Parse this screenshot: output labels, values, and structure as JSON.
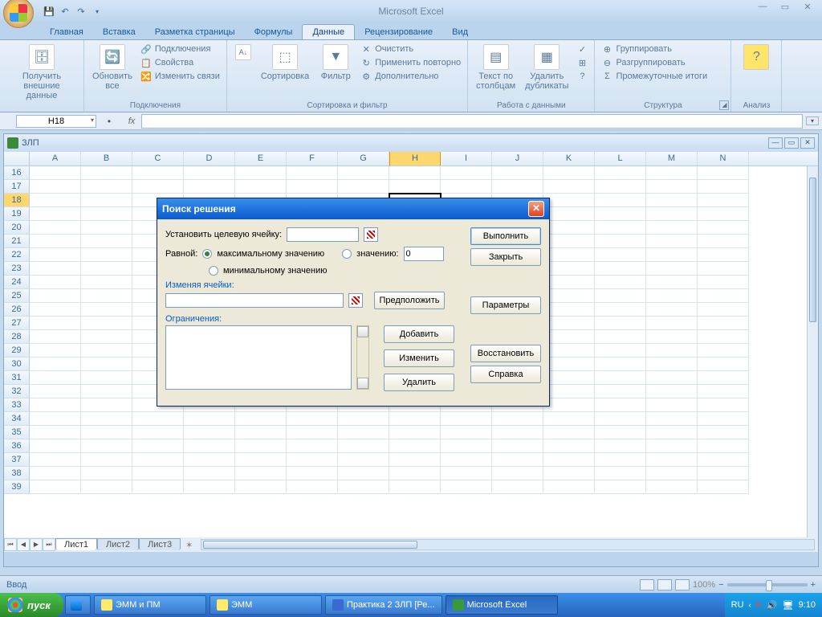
{
  "app": {
    "title": "Microsoft Excel"
  },
  "tabs": [
    "Главная",
    "Вставка",
    "Разметка страницы",
    "Формулы",
    "Данные",
    "Рецензирование",
    "Вид"
  ],
  "active_tab": 4,
  "ribbon": {
    "g1": {
      "btn": "Получить\nвнешние данные",
      "label": ""
    },
    "g2": {
      "btn": "Обновить\nвсе",
      "items": [
        "Подключения",
        "Свойства",
        "Изменить связи"
      ],
      "label": "Подключения"
    },
    "g3": {
      "btn": "Сортировка",
      "btn2": "Фильтр",
      "items": [
        "Очистить",
        "Применить повторно",
        "Дополнительно"
      ],
      "label": "Сортировка и фильтр"
    },
    "g4": {
      "btn1": "Текст по\nстолбцам",
      "btn2": "Удалить\nдубликаты",
      "label": "Работа с данными"
    },
    "g5": {
      "items": [
        "Группировать",
        "Разгруппировать",
        "Промежуточные итоги"
      ],
      "label": "Структура"
    },
    "g6": {
      "label": "Анализ"
    }
  },
  "namebox": "H18",
  "workbook": {
    "title": "ЗЛП",
    "cols": [
      "A",
      "B",
      "C",
      "D",
      "E",
      "F",
      "G",
      "H",
      "I",
      "J",
      "K",
      "L",
      "M",
      "N"
    ],
    "first_row": 16,
    "row_count": 24,
    "active": {
      "row": 18,
      "col": "H"
    },
    "sheets": [
      "Лист1",
      "Лист2",
      "Лист3"
    ]
  },
  "status": {
    "left": "Ввод",
    "zoom": "100%"
  },
  "dialog": {
    "title": "Поиск решения",
    "target_label": "Установить целевую ячейку:",
    "equal_label": "Равной:",
    "opt_max": "максимальному значению",
    "opt_value": "значению:",
    "opt_min": "минимальному значению",
    "val_input": "0",
    "changing": "Изменяя ячейки:",
    "guess": "Предположить",
    "constraints": "Ограничения:",
    "add": "Добавить",
    "change": "Изменить",
    "delete": "Удалить",
    "execute": "Выполнить",
    "close": "Закрыть",
    "params": "Параметры",
    "restore": "Восстановить",
    "help": "Справка"
  },
  "taskbar": {
    "start": "пуск",
    "items": [
      "ЭММ и ПМ",
      "ЭММ",
      "Практика 2 ЗЛП [Ре...",
      "Microsoft Excel"
    ],
    "lang": "RU",
    "time": "9:10"
  }
}
